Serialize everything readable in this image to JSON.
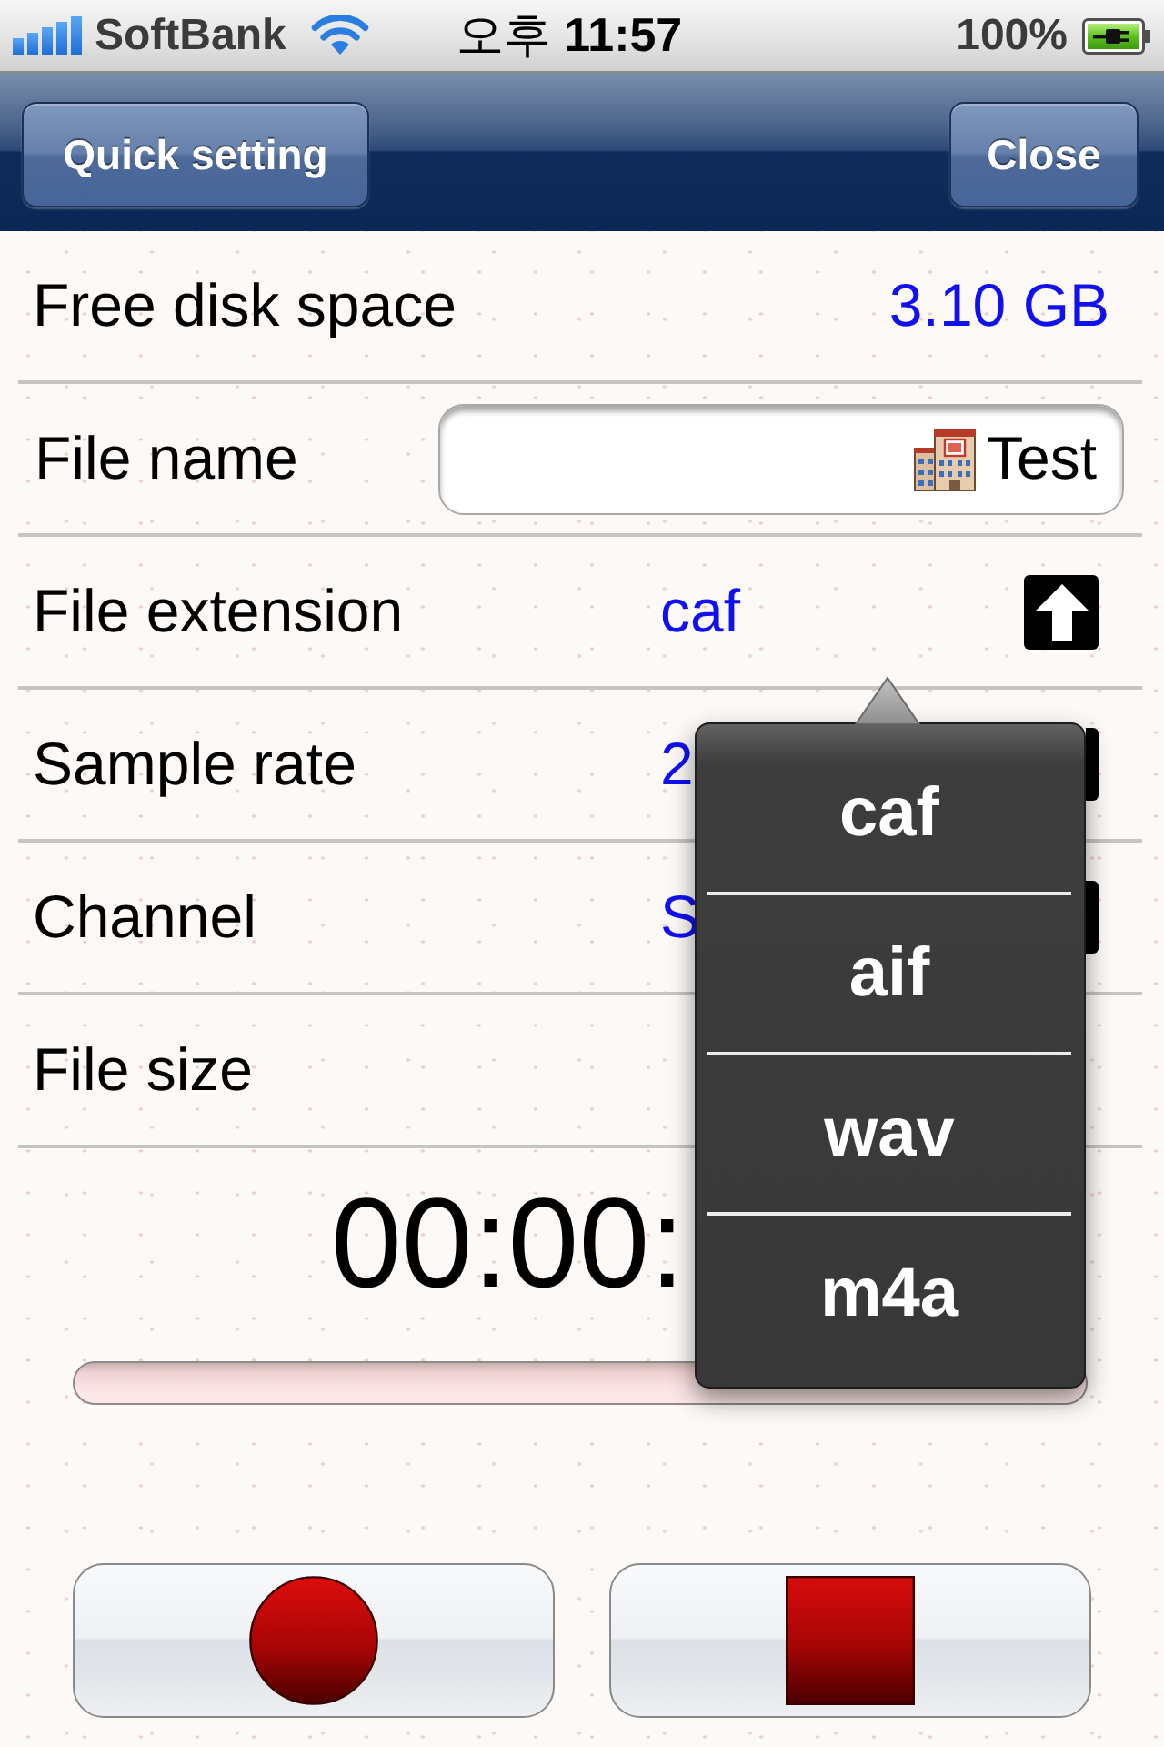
{
  "status_bar": {
    "carrier": "SoftBank",
    "time": "오후 **11:57**",
    "battery": "100%"
  },
  "nav_bar": {
    "left_button": "Quick setting",
    "right_button": "Close"
  },
  "settings": [
    {
      "kind": "value",
      "label": "Free disk space",
      "value": "3.10 GB"
    },
    {
      "kind": "text_field",
      "label": "File name",
      "value": "Test"
    },
    {
      "kind": "picker",
      "label": "File extension",
      "value": "caf",
      "expanded": true
    },
    {
      "kind": "picker",
      "label": "Sample rate",
      "value": "2",
      "expanded": false
    },
    {
      "kind": "picker",
      "label": "Channel",
      "value": "S",
      "expanded": false
    },
    {
      "kind": "value",
      "label": "File size"
    }
  ],
  "timer": "00:00:",
  "popover": {
    "options": [
      {
        "label": "caf"
      },
      {
        "label": "aif"
      },
      {
        "label": "wav"
      },
      {
        "label": "m4a"
      }
    ]
  }
}
